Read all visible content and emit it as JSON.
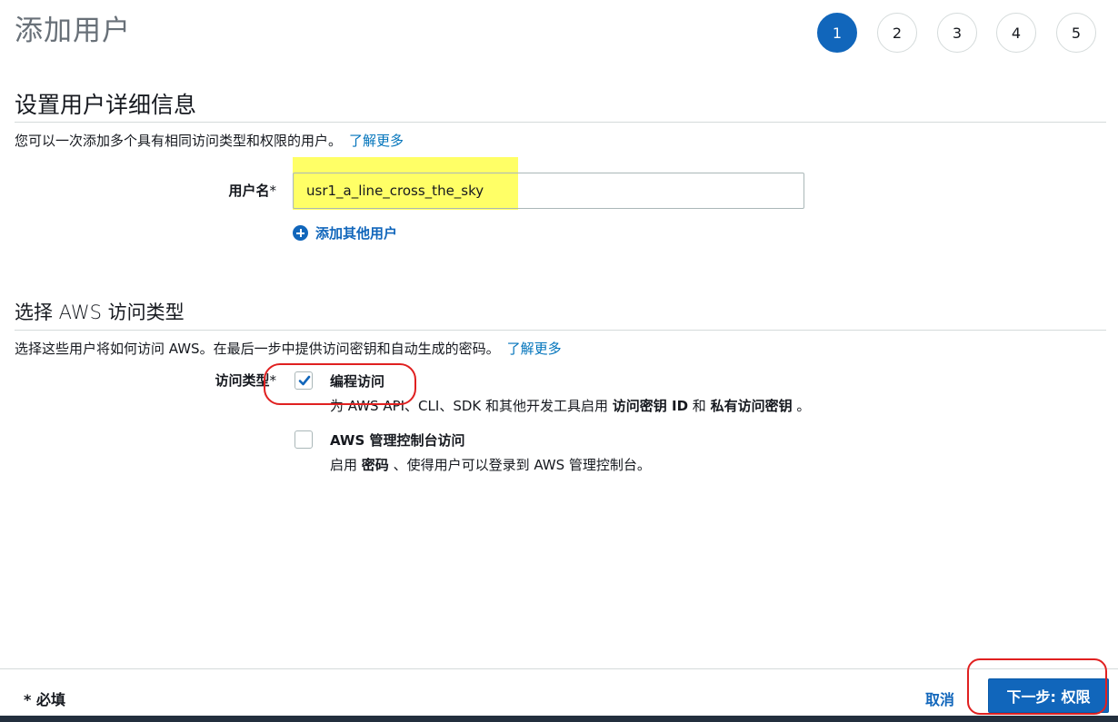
{
  "page": {
    "title": "添加用户"
  },
  "stepper": {
    "steps": [
      "1",
      "2",
      "3",
      "4",
      "5"
    ],
    "active": "1"
  },
  "details": {
    "heading": "设置用户详细信息",
    "description": "您可以一次添加多个具有相同访问类型和权限的用户。",
    "learn_more": "了解更多",
    "username_label": "用户名",
    "required_mark": "*",
    "username_value": "usr1_a_line_cross_the_sky",
    "add_user_label": "添加其他用户"
  },
  "access": {
    "heading": "选择 AWS 访问类型",
    "description": "选择这些用户将如何访问 AWS。在最后一步中提供访问密钥和自动生成的密码。",
    "learn_more": "了解更多",
    "type_label": "访问类型",
    "required_mark": "*",
    "options": [
      {
        "title": "编程访问",
        "checked": true,
        "desc_prefix": "为 AWS API、CLI、SDK 和其他开发工具启用 ",
        "desc_bold1": "访问密钥 ID",
        "desc_mid": " 和 ",
        "desc_bold2": "私有访问密钥",
        "desc_suffix": " 。"
      },
      {
        "title": "AWS 管理控制台访问",
        "checked": false,
        "desc_prefix": "启用 ",
        "desc_bold1": "密码",
        "desc_suffix": " 、使得用户可以登录到 AWS 管理控制台。"
      }
    ]
  },
  "footer": {
    "required_note": "* 必填",
    "cancel_label": "取消",
    "next_label": "下一步: 权限"
  },
  "colors": {
    "primary": "#1166bb",
    "link": "#0073bb",
    "highlight": "#ffff66",
    "annotation": "#e02020"
  }
}
